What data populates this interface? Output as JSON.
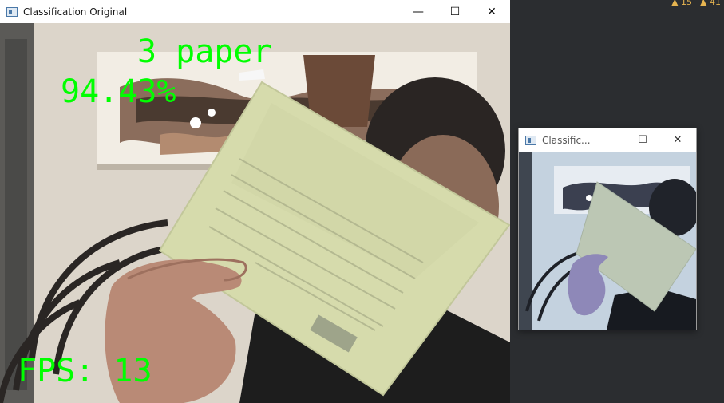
{
  "ide": {
    "warnings": "▲ 15",
    "notices": "▲ 41"
  },
  "main_window": {
    "title": "Classification Original",
    "controls": {
      "minimize": "—",
      "maximize": "☐",
      "close": "✕"
    },
    "overlay": {
      "class_label": "3 paper",
      "confidence": "94.43%",
      "fps": "FPS: 13"
    }
  },
  "small_window": {
    "title": "Classific...",
    "controls": {
      "minimize": "—",
      "maximize": "☐",
      "close": "✕"
    }
  },
  "colors": {
    "overlay_text": "#00ff00",
    "paper": "#d8dcb0",
    "wall": "#dcd6cc"
  }
}
